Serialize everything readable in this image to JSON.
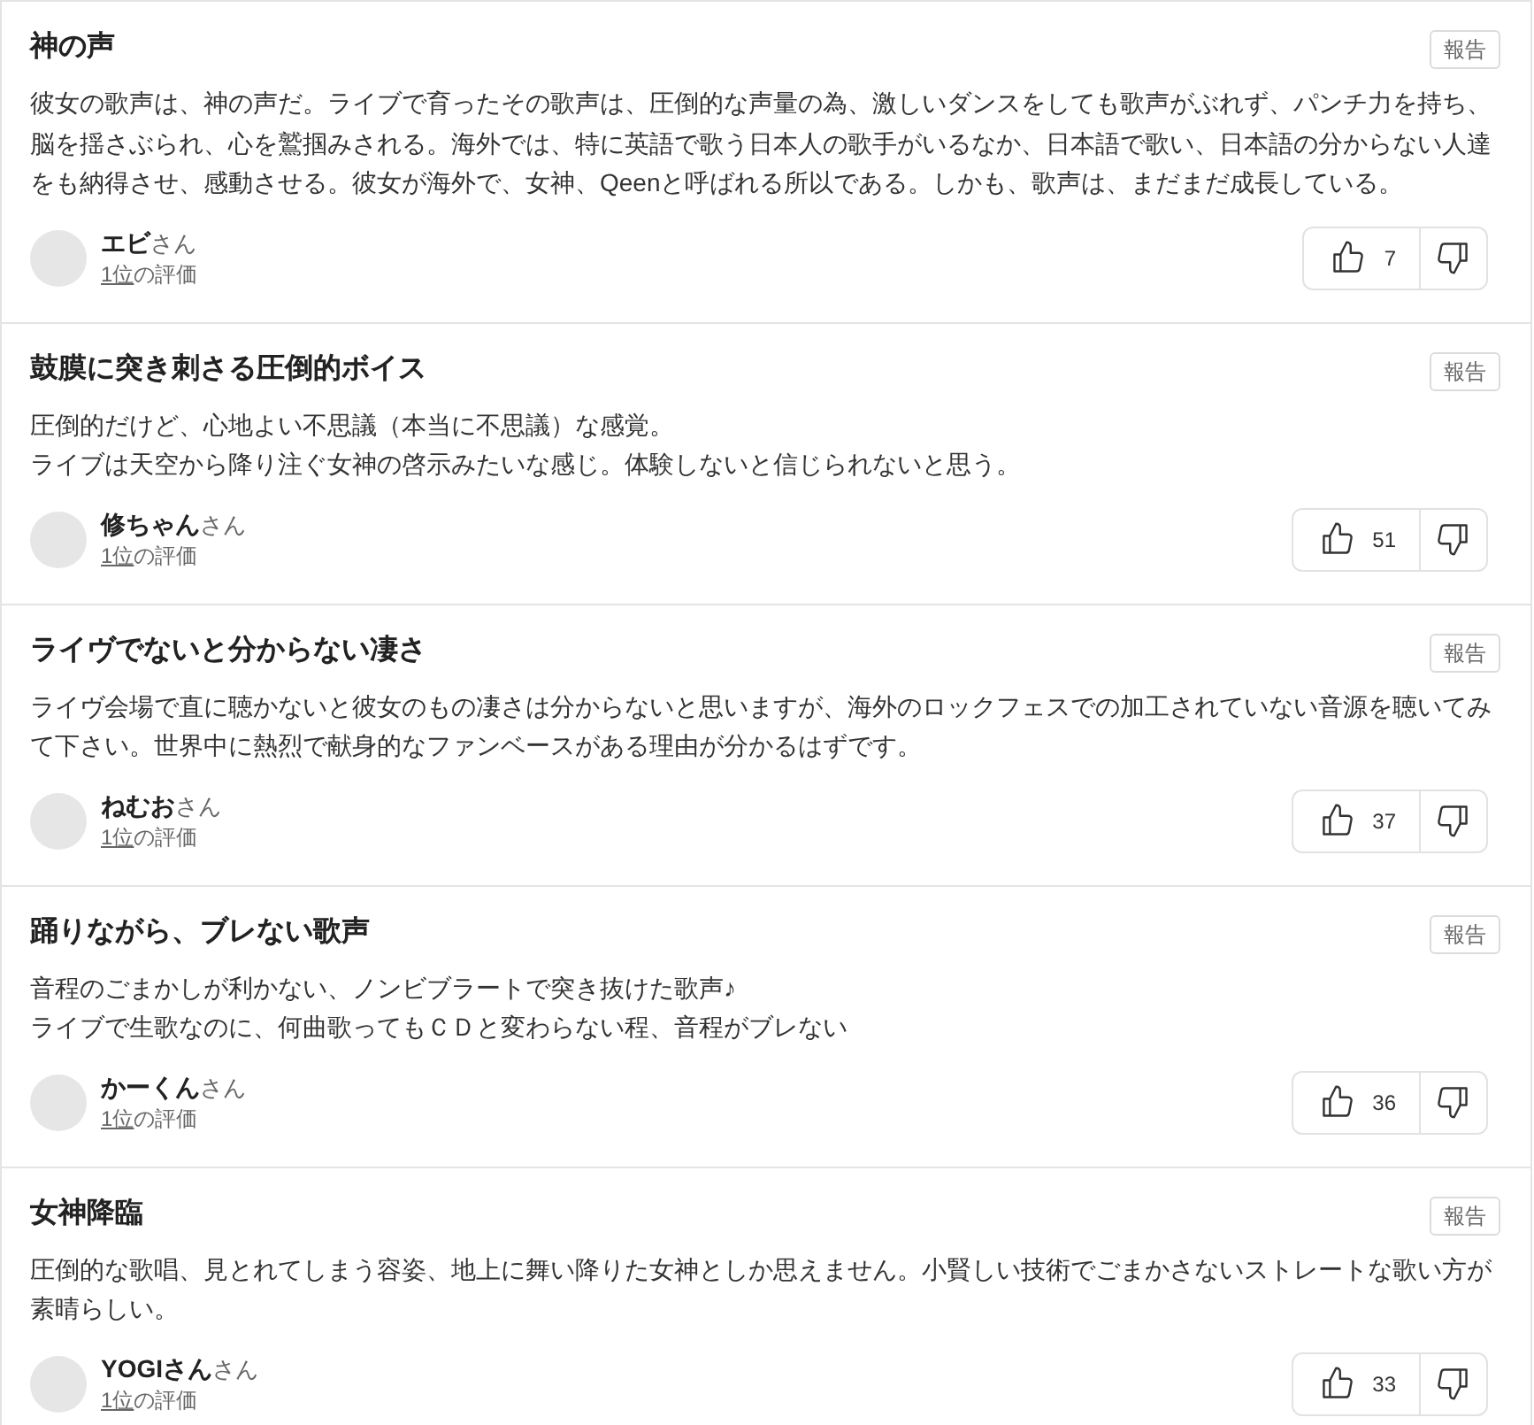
{
  "reviews": [
    {
      "title": "神の声",
      "report_button": "報告",
      "body_lines": [
        "彼女の歌声は、神の声だ。ライブで育ったその歌声は、圧倒的な声量の為、激しいダンスをしても歌声がぶれず、パンチ力を持ち、脳を揺さぶられ、心を鷲掴みされる。海外では、特に英語で歌う日本人の歌手がいるなか、日本語で歌い、日本語の分からない人達をも納得させ、感動させる。彼女が海外で、女神、Qeenと呼ばれる所以である。しかも、歌声は、まだまだ成長している。"
      ],
      "author": "**エビ**さん",
      "rank_link": "1位",
      "rank_suffix": "の評価",
      "up_count": "7"
    },
    {
      "title": "鼓膜に突き刺さる圧倒的ボイス",
      "report_button": "報告",
      "body_lines": [
        "圧倒的だけど、心地よい不思議（本当に不思議）な感覚。",
        "ライブは天空から降り注ぐ女神の啓示みたいな感じ。体験しないと信じられないと思う。"
      ],
      "author": "**修ちゃん**さん",
      "rank_link": "1位",
      "rank_suffix": "の評価",
      "up_count": "51"
    },
    {
      "title": "ライヴでないと分からない凄さ",
      "report_button": "報告",
      "body_lines": [
        "ライヴ会場で直に聴かないと彼女のもの凄さは分からないと思いますが、海外のロックフェスでの加工されていない音源を聴いてみて下さい。世界中に熱烈で献身的なファンベースがある理由が分かるはずです。"
      ],
      "author": "**ねむお**さん",
      "rank_link": "1位",
      "rank_suffix": "の評価",
      "up_count": "37"
    },
    {
      "title": "踊りながら、ブレない歌声",
      "report_button": "報告",
      "body_lines": [
        "音程のごまかしが利かない、ノンビブラートで突き抜けた歌声♪",
        "ライブで生歌なのに、何曲歌ってもＣＤと変わらない程、音程がブレない"
      ],
      "author": "**かーくん**さん",
      "rank_link": "1位",
      "rank_suffix": "の評価",
      "up_count": "36"
    },
    {
      "title": "女神降臨",
      "report_button": "報告",
      "body_lines": [
        "圧倒的な歌唱、見とれてしまう容姿、地上に舞い降りた女神としか思えません。小賢しい技術でごまかさないストレートな歌い方が素晴らしい。"
      ],
      "author": "**YOGIさん**さん",
      "rank_link": "1位",
      "rank_suffix": "の評価",
      "up_count": "33"
    }
  ]
}
